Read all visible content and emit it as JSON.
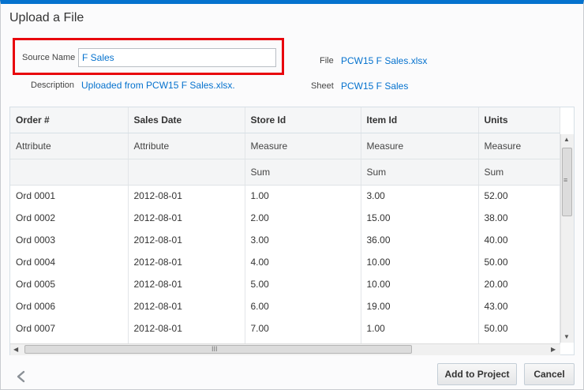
{
  "dialog": {
    "title": "Upload a File"
  },
  "form": {
    "source_name_label": "Source Name",
    "source_name_value": "F Sales",
    "description_label": "Description",
    "description_value": "Uploaded from PCW15 F Sales.xlsx.",
    "file_label": "File",
    "file_value": "PCW15 F Sales.xlsx",
    "sheet_label": "Sheet",
    "sheet_value": "PCW15 F Sales"
  },
  "grid": {
    "columns": [
      "Order #",
      "Sales Date",
      "Store Id",
      "Item Id",
      "Units"
    ],
    "types": [
      "Attribute",
      "Attribute",
      "Measure",
      "Measure",
      "Measure"
    ],
    "aggregations": [
      "",
      "",
      "Sum",
      "Sum",
      "Sum"
    ],
    "rows": [
      [
        "Ord 0001",
        "2012-08-01",
        "1.00",
        "3.00",
        "52.00"
      ],
      [
        "Ord 0002",
        "2012-08-01",
        "2.00",
        "15.00",
        "38.00"
      ],
      [
        "Ord 0003",
        "2012-08-01",
        "3.00",
        "36.00",
        "40.00"
      ],
      [
        "Ord 0004",
        "2012-08-01",
        "4.00",
        "10.00",
        "50.00"
      ],
      [
        "Ord 0005",
        "2012-08-01",
        "5.00",
        "10.00",
        "20.00"
      ],
      [
        "Ord 0006",
        "2012-08-01",
        "6.00",
        "19.00",
        "43.00"
      ],
      [
        "Ord 0007",
        "2012-08-01",
        "7.00",
        "1.00",
        "50.00"
      ],
      [
        "",
        "",
        "",
        "",
        ""
      ]
    ]
  },
  "footer": {
    "add_label": "Add to Project",
    "cancel_label": "Cancel"
  },
  "icons": {
    "back": "chevron-left-icon",
    "scroll_up": "triangle-up",
    "scroll_down": "triangle-down",
    "scroll_left": "triangle-left",
    "scroll_right": "triangle-right"
  },
  "colors": {
    "accent": "#0572ce",
    "highlight": "#e8050d"
  }
}
